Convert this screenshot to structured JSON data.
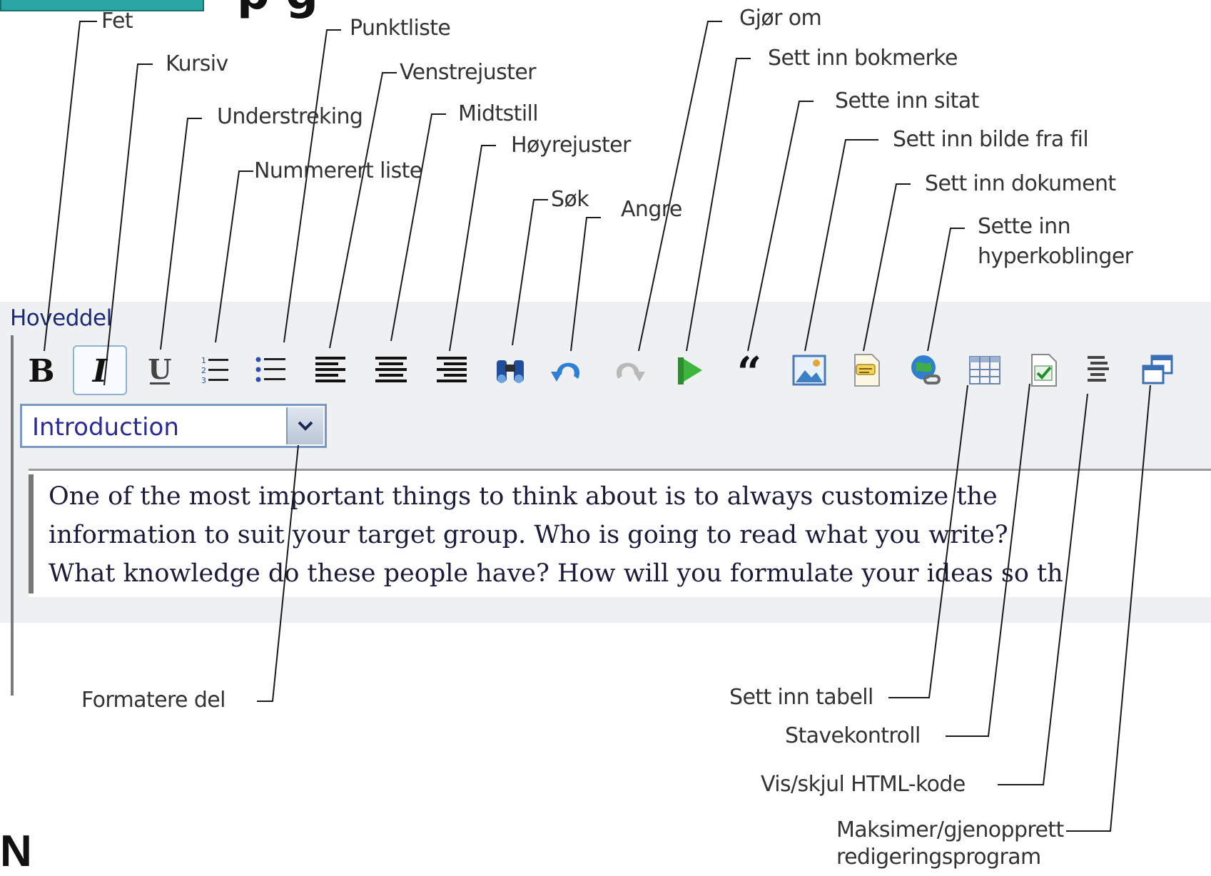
{
  "section_title": "Hoveddel",
  "format_select": {
    "value": "Introduction"
  },
  "editor_text": [
    "One of the most important things to think about is to always customize the",
    "information to suit your target group. Who is going to read what you write?",
    "What knowledge do these people have? How will you formulate your ideas so th"
  ],
  "callouts": {
    "fet": "Fet",
    "kursiv": "Kursiv",
    "understreking": "Understreking",
    "nummerert_liste": "Nummerert liste",
    "punktliste": "Punktliste",
    "venstrejuster": "Venstrejuster",
    "midtstill": "Midtstill",
    "hoyrejuster": "Høyrejuster",
    "sok": "Søk",
    "angre": "Angre",
    "gjor_om": "Gjør om",
    "sett_inn_bokmerke": "Sett inn bokmerke",
    "sette_inn_sitat": "Sette inn sitat",
    "sett_inn_bilde": "Sett inn bilde fra fil",
    "sett_inn_dokument": "Sett inn dokument",
    "sette_inn_hyperkoblinger_1": "Sette inn",
    "sette_inn_hyperkoblinger_2": "hyperkoblinger",
    "formatere_del": "Formatere del",
    "sett_inn_tabell": "Sett inn tabell",
    "stavekontroll": "Stavekontroll",
    "vis_skjul_html": "Vis/skjul HTML-kode",
    "maksimer_1": "Maksimer/gjenopprett",
    "maksimer_2": "redigeringsprogram"
  },
  "cut_off_text": {
    "heading_fragment": "p g",
    "corner_letter": "N"
  },
  "colors": {
    "panel": "#eef0f2",
    "accent_teal": "#2aa7a4",
    "select_border": "#7a98c4"
  }
}
